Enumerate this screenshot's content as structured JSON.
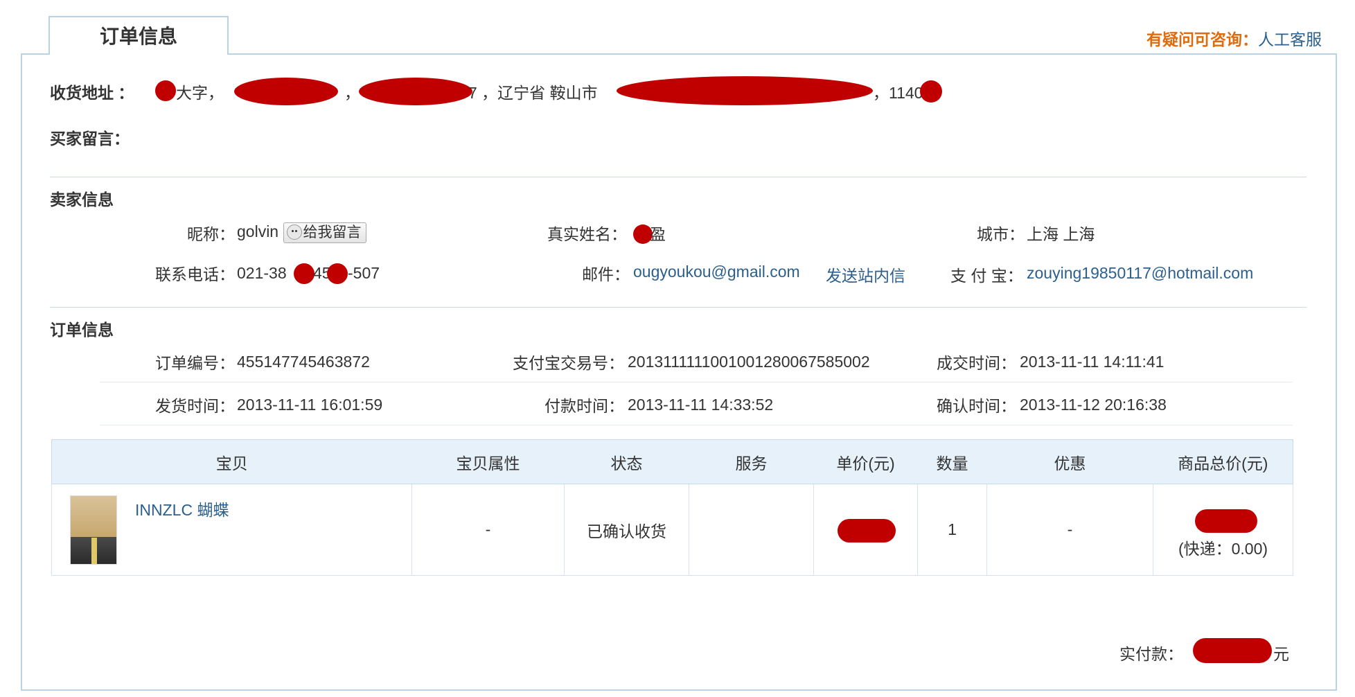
{
  "tab": {
    "label": "订单信息"
  },
  "help": {
    "question": "有疑问可咨询：",
    "service_link": "人工客服"
  },
  "address": {
    "label": "收货地址 ：",
    "name_part": "大字，",
    "sep1": "，",
    "sep2": "7 ，辽宁省 鞍山市",
    "sep3": "，1140"
  },
  "buyer_message": {
    "label": "买家留言：",
    "value": ""
  },
  "seller": {
    "title": "卖家信息",
    "nickname_label": "昵称：",
    "nickname": "golvin",
    "message_button": "给我留言",
    "realname_label": "真实姓名：",
    "realname": "盈",
    "city_label": "城市：",
    "city": "上海 上海",
    "phone_label": "联系电话：",
    "phone_a": "021-38",
    "phone_b": "45",
    "phone_c": "-507",
    "email_label": "邮件：",
    "email": "ougyoukou@gmail.com",
    "site_message_link": "发送站内信",
    "alipay_label": "支 付 宝：",
    "alipay": "zouying19850117@hotmail.com"
  },
  "order": {
    "title": "订单信息",
    "order_no_label": "订单编号：",
    "order_no": "455147745463872",
    "alipay_trade_label": "支付宝交易号：",
    "alipay_trade": "2013111111001001280067585002",
    "deal_time_label": "成交时间：",
    "deal_time": "2013-11-11 14:11:41",
    "ship_time_label": "发货时间：",
    "ship_time": "2013-11-11 16:01:59",
    "pay_time_label": "付款时间：",
    "pay_time": "2013-11-11 14:33:52",
    "confirm_time_label": "确认时间：",
    "confirm_time": "2013-11-12 20:16:38"
  },
  "items_table": {
    "headers": [
      "宝贝",
      "宝贝属性",
      "状态",
      "服务",
      "单价(元)",
      "数量",
      "优惠",
      "商品总价(元)"
    ],
    "rows": [
      {
        "name": "INNZLC 蝴蝶",
        "attributes": "-",
        "status": "已确认收货",
        "service": "",
        "quantity": "1",
        "discount": "-",
        "shipping": "(快递：0.00)"
      }
    ]
  },
  "total": {
    "label": "实付款：",
    "unit": "元"
  },
  "colors": {
    "accent_orange": "#e06b0c",
    "link_blue": "#2b5f8e",
    "border_blue": "#b9d3e4",
    "redaction": "#c00000"
  }
}
